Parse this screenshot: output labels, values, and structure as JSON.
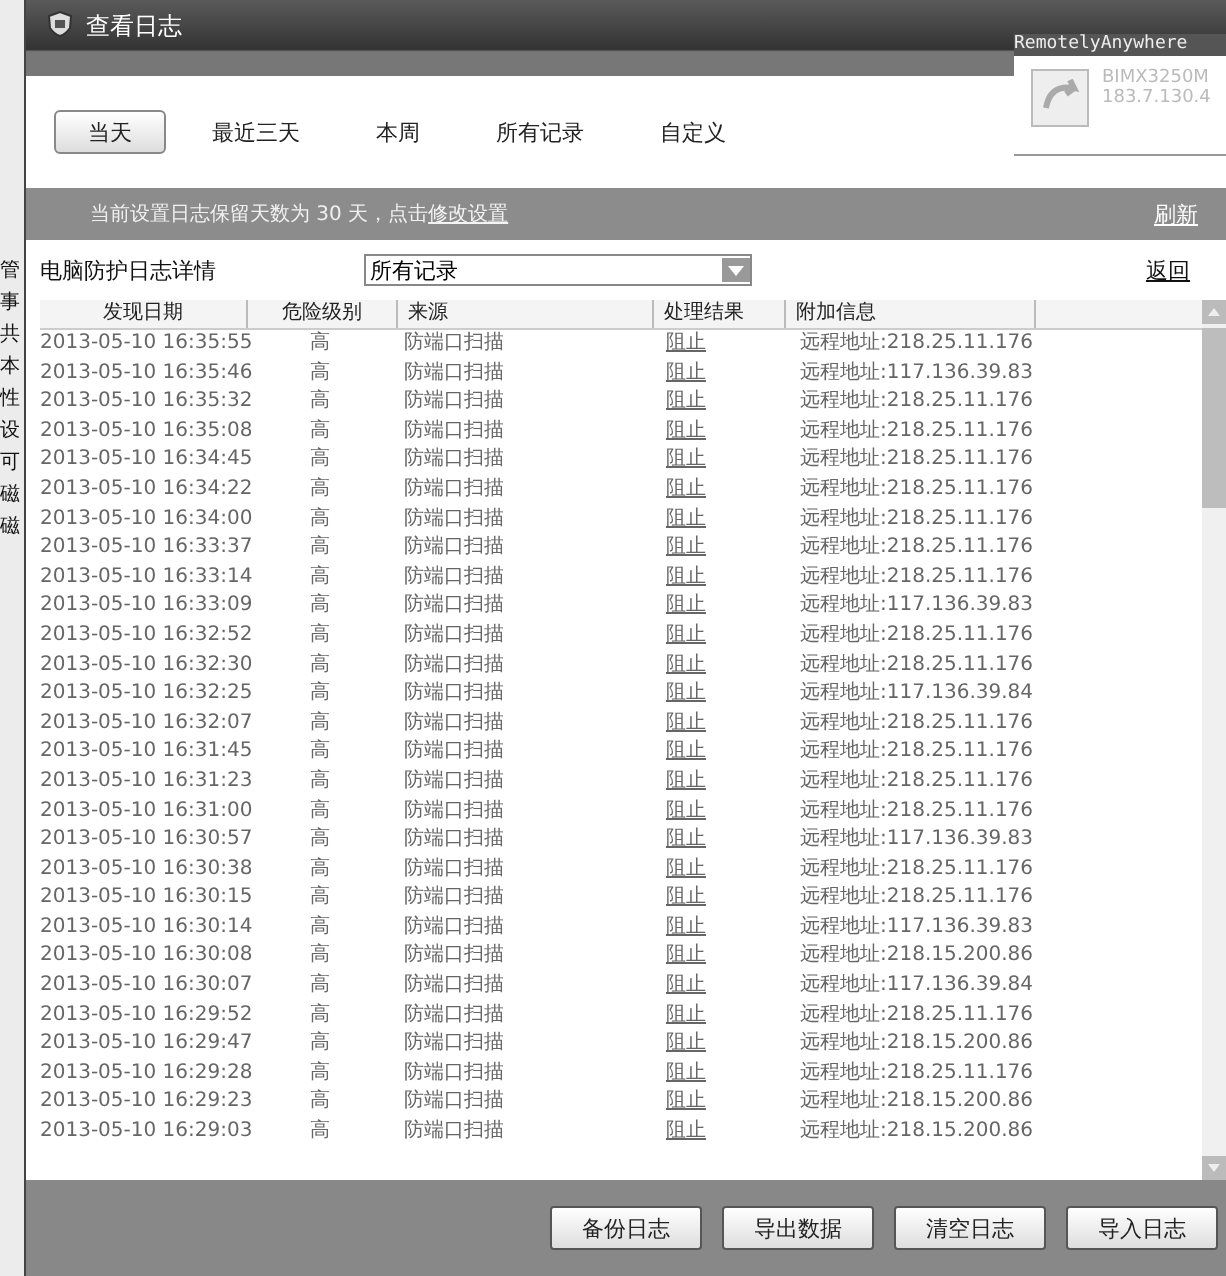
{
  "background_window": {
    "side_chars": [
      "管",
      "事",
      "共",
      "本",
      "性",
      "设",
      "可",
      "磁",
      "磁"
    ]
  },
  "window": {
    "title": "查看日志"
  },
  "remote_overlay": {
    "title": "RemotelyAnywhere",
    "host": "BIMX3250M",
    "address": "183.7.130.4"
  },
  "tabs": [
    {
      "label": "当天",
      "selected": true
    },
    {
      "label": "最近三天",
      "selected": false
    },
    {
      "label": "本周",
      "selected": false
    },
    {
      "label": "所有记录",
      "selected": false
    },
    {
      "label": "自定义",
      "selected": false
    }
  ],
  "retention_notice": {
    "text": "当前设置日志保留天数为 30 天，点击",
    "link": "修改设置"
  },
  "refresh": "刷新",
  "filter": {
    "label": "电脑防护日志详情",
    "value": "所有记录"
  },
  "back": "返回",
  "table": {
    "columns": [
      "发现日期",
      "危险级别",
      "来源",
      "处理结果",
      "附加信息"
    ],
    "rows": [
      [
        "2013-05-10 16:35:55",
        "高",
        "防端口扫描",
        "阻止",
        "远程地址:218.25.11.176"
      ],
      [
        "2013-05-10 16:35:46",
        "高",
        "防端口扫描",
        "阻止",
        "远程地址:117.136.39.83"
      ],
      [
        "2013-05-10 16:35:32",
        "高",
        "防端口扫描",
        "阻止",
        "远程地址:218.25.11.176"
      ],
      [
        "2013-05-10 16:35:08",
        "高",
        "防端口扫描",
        "阻止",
        "远程地址:218.25.11.176"
      ],
      [
        "2013-05-10 16:34:45",
        "高",
        "防端口扫描",
        "阻止",
        "远程地址:218.25.11.176"
      ],
      [
        "2013-05-10 16:34:22",
        "高",
        "防端口扫描",
        "阻止",
        "远程地址:218.25.11.176"
      ],
      [
        "2013-05-10 16:34:00",
        "高",
        "防端口扫描",
        "阻止",
        "远程地址:218.25.11.176"
      ],
      [
        "2013-05-10 16:33:37",
        "高",
        "防端口扫描",
        "阻止",
        "远程地址:218.25.11.176"
      ],
      [
        "2013-05-10 16:33:14",
        "高",
        "防端口扫描",
        "阻止",
        "远程地址:218.25.11.176"
      ],
      [
        "2013-05-10 16:33:09",
        "高",
        "防端口扫描",
        "阻止",
        "远程地址:117.136.39.83"
      ],
      [
        "2013-05-10 16:32:52",
        "高",
        "防端口扫描",
        "阻止",
        "远程地址:218.25.11.176"
      ],
      [
        "2013-05-10 16:32:30",
        "高",
        "防端口扫描",
        "阻止",
        "远程地址:218.25.11.176"
      ],
      [
        "2013-05-10 16:32:25",
        "高",
        "防端口扫描",
        "阻止",
        "远程地址:117.136.39.84"
      ],
      [
        "2013-05-10 16:32:07",
        "高",
        "防端口扫描",
        "阻止",
        "远程地址:218.25.11.176"
      ],
      [
        "2013-05-10 16:31:45",
        "高",
        "防端口扫描",
        "阻止",
        "远程地址:218.25.11.176"
      ],
      [
        "2013-05-10 16:31:23",
        "高",
        "防端口扫描",
        "阻止",
        "远程地址:218.25.11.176"
      ],
      [
        "2013-05-10 16:31:00",
        "高",
        "防端口扫描",
        "阻止",
        "远程地址:218.25.11.176"
      ],
      [
        "2013-05-10 16:30:57",
        "高",
        "防端口扫描",
        "阻止",
        "远程地址:117.136.39.83"
      ],
      [
        "2013-05-10 16:30:38",
        "高",
        "防端口扫描",
        "阻止",
        "远程地址:218.25.11.176"
      ],
      [
        "2013-05-10 16:30:15",
        "高",
        "防端口扫描",
        "阻止",
        "远程地址:218.25.11.176"
      ],
      [
        "2013-05-10 16:30:14",
        "高",
        "防端口扫描",
        "阻止",
        "远程地址:117.136.39.83"
      ],
      [
        "2013-05-10 16:30:08",
        "高",
        "防端口扫描",
        "阻止",
        "远程地址:218.15.200.86"
      ],
      [
        "2013-05-10 16:30:07",
        "高",
        "防端口扫描",
        "阻止",
        "远程地址:117.136.39.84"
      ],
      [
        "2013-05-10 16:29:52",
        "高",
        "防端口扫描",
        "阻止",
        "远程地址:218.25.11.176"
      ],
      [
        "2013-05-10 16:29:47",
        "高",
        "防端口扫描",
        "阻止",
        "远程地址:218.15.200.86"
      ],
      [
        "2013-05-10 16:29:28",
        "高",
        "防端口扫描",
        "阻止",
        "远程地址:218.25.11.176"
      ],
      [
        "2013-05-10 16:29:23",
        "高",
        "防端口扫描",
        "阻止",
        "远程地址:218.15.200.86"
      ],
      [
        "2013-05-10 16:29:03",
        "高",
        "防端口扫描",
        "阻止",
        "远程地址:218.15.200.86"
      ]
    ]
  },
  "buttons": [
    "备份日志",
    "导出数据",
    "清空日志",
    "导入日志"
  ]
}
